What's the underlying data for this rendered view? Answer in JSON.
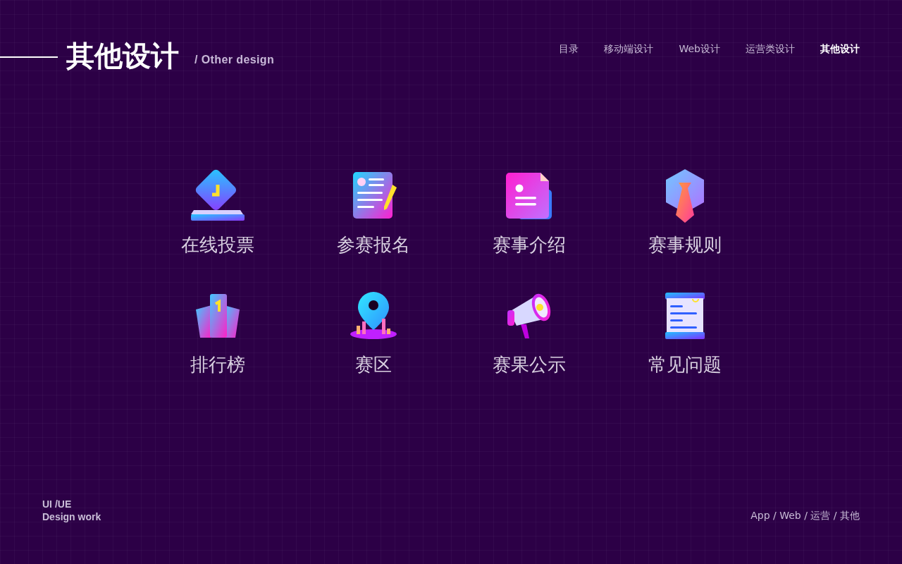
{
  "header": {
    "title": "其他设计",
    "subtitle": "/ Other design"
  },
  "nav": [
    {
      "label": "目录",
      "selected": false
    },
    {
      "label": "移动端设计",
      "selected": false
    },
    {
      "label": "Web设计",
      "selected": false
    },
    {
      "label": "运营类设计",
      "selected": false
    },
    {
      "label": "其他设计",
      "selected": true
    }
  ],
  "items": [
    {
      "label": "在线投票",
      "kind": "ballot"
    },
    {
      "label": "参赛报名",
      "kind": "form"
    },
    {
      "label": "赛事介绍",
      "kind": "doc"
    },
    {
      "label": "赛事规则",
      "kind": "tie"
    },
    {
      "label": "排行榜",
      "kind": "podium"
    },
    {
      "label": "赛区",
      "kind": "pin"
    },
    {
      "label": "赛果公示",
      "kind": "megaphone"
    },
    {
      "label": "常见问题",
      "kind": "list"
    }
  ],
  "footer": {
    "brand_line_1": "UI /UE",
    "brand_line_2": "Design work",
    "categories": "App / Web / 运营 / 其他"
  }
}
